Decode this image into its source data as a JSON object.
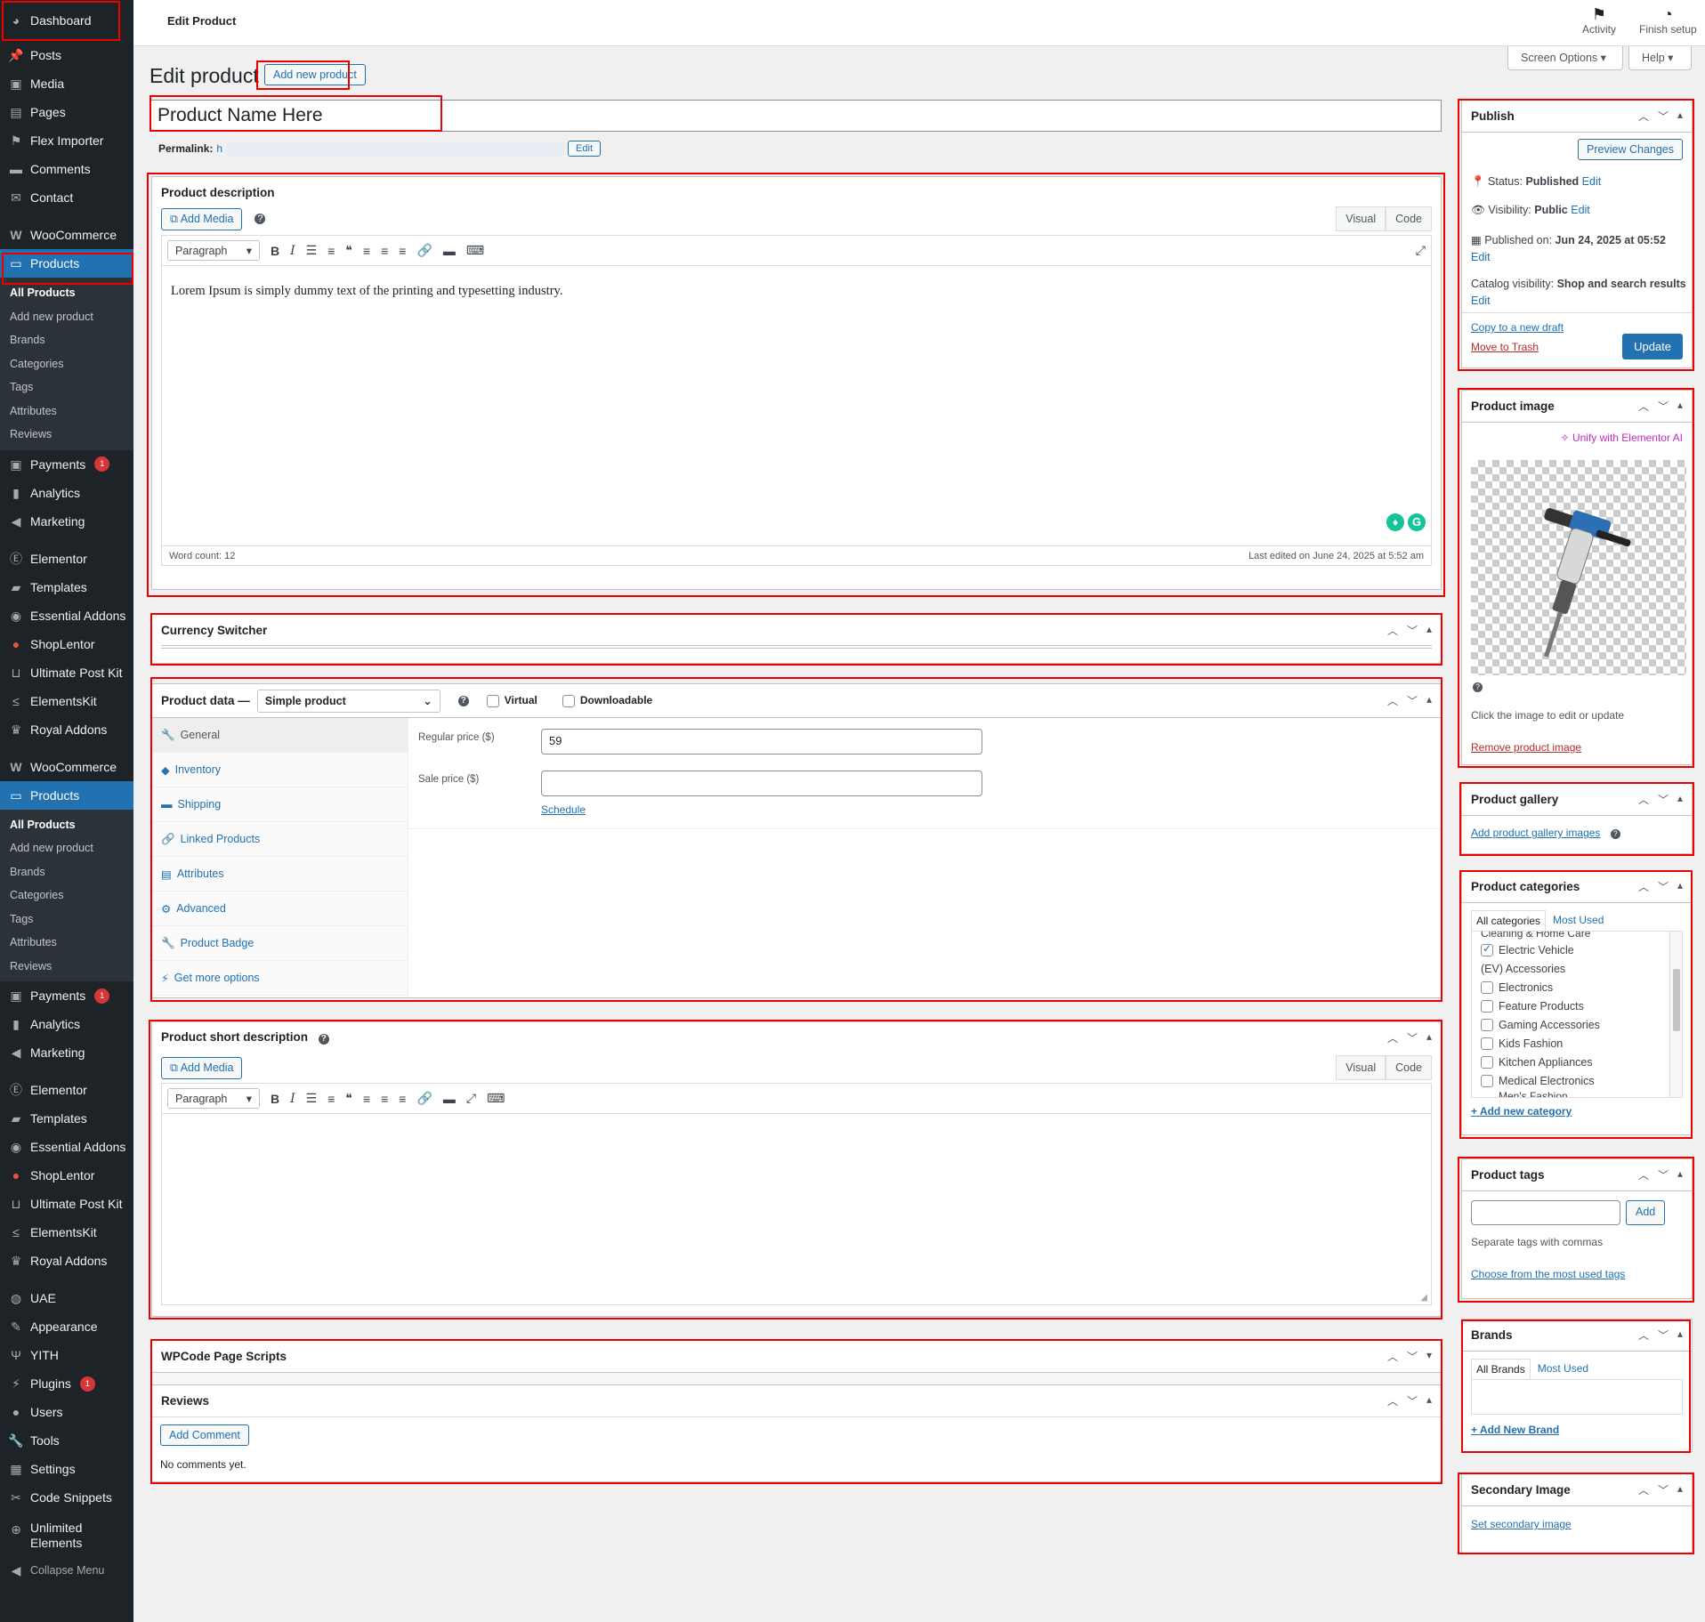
{
  "sidebar": {
    "dashboard": "Dashboard",
    "posts": "Posts",
    "media": "Media",
    "pages": "Pages",
    "flex_importer": "Flex Importer",
    "comments": "Comments",
    "contact": "Contact",
    "woocommerce": "WooCommerce",
    "products": "Products",
    "products_sub": [
      "All Products",
      "Add new product",
      "Brands",
      "Categories",
      "Tags",
      "Attributes",
      "Reviews"
    ],
    "payments": "Payments",
    "payments_badge": "1",
    "analytics": "Analytics",
    "marketing": "Marketing",
    "elementor": "Elementor",
    "templates": "Templates",
    "essential_addons": "Essential Addons",
    "shoplentor": "ShopLentor",
    "ultimate_post_kit": "Ultimate Post Kit",
    "elementskit": "ElementsKit",
    "royal_addons": "Royal Addons",
    "uae": "UAE",
    "appearance": "Appearance",
    "yith": "YITH",
    "plugins": "Plugins",
    "plugins_badge": "1",
    "users": "Users",
    "tools": "Tools",
    "settings": "Settings",
    "code_snippets": "Code Snippets",
    "unlimited_elements_1": "Unlimited",
    "unlimited_elements_2": "Elements",
    "collapse": "Collapse Menu"
  },
  "topbar": {
    "title": "Edit Product",
    "activity": "Activity",
    "finish_setup": "Finish setup",
    "screen_options": "Screen Options ▾",
    "help": "Help ▾"
  },
  "main": {
    "heading": "Edit product",
    "add_new": "Add new product",
    "product_name": "Product Name Here",
    "permalink_label": "Permalink:",
    "permalink_value": "h",
    "permalink_edit": "Edit"
  },
  "description": {
    "title": "Product description",
    "add_media": "Add Media",
    "tab_visual": "Visual",
    "tab_code": "Code",
    "format": "Paragraph",
    "content": "Lorem Ipsum is simply dummy text of the printing and typesetting industry.",
    "word_count": "Word count: 12",
    "last_edited": "Last edited on June 24, 2025 at 5:52 am"
  },
  "currency": {
    "title": "Currency Switcher"
  },
  "product_data": {
    "title": "Product data —",
    "type": "Simple product",
    "virtual": "Virtual",
    "downloadable": "Downloadable",
    "tabs": [
      "General",
      "Inventory",
      "Shipping",
      "Linked Products",
      "Attributes",
      "Advanced",
      "Product Badge",
      "Get more options"
    ],
    "regular_price_label": "Regular price ($)",
    "regular_price": "59",
    "sale_price_label": "Sale price ($)",
    "sale_price": "",
    "schedule": "Schedule"
  },
  "short_description": {
    "title": "Product short description",
    "add_media": "Add Media",
    "tab_visual": "Visual",
    "tab_code": "Code",
    "format": "Paragraph"
  },
  "wpcode": {
    "title": "WPCode Page Scripts"
  },
  "reviews": {
    "title": "Reviews",
    "add_comment": "Add Comment",
    "empty": "No comments yet."
  },
  "publish": {
    "title": "Publish",
    "preview": "Preview Changes",
    "status_label": "Status:",
    "status_value": "Published",
    "visibility_label": "Visibility:",
    "visibility_value": "Public",
    "published_label": "Published on:",
    "published_value": "Jun 24, 2025 at 05:52",
    "catalog_label": "Catalog visibility:",
    "catalog_value": "Shop and search results",
    "edit": "Edit",
    "copy_draft": "Copy to a new draft",
    "trash": "Move to Trash",
    "update": "Update"
  },
  "product_image": {
    "title": "Product image",
    "unify": "Unify with Elementor AI",
    "hint": "Click the image to edit or update",
    "remove": "Remove product image"
  },
  "gallery": {
    "title": "Product gallery",
    "add": "Add product gallery images"
  },
  "categories": {
    "title": "Product categories",
    "tab_all": "All categories",
    "tab_most": "Most Used",
    "cut_top": "Cleaning & Home Care",
    "items": [
      {
        "label": "Electric Vehicle",
        "checked": true,
        "box": true
      },
      {
        "label": "(EV) Accessories",
        "checked": false,
        "box": false
      },
      {
        "label": "Electronics",
        "checked": false,
        "box": true
      },
      {
        "label": "Feature Products",
        "checked": false,
        "box": true
      },
      {
        "label": "Gaming Accessories",
        "checked": false,
        "box": true
      },
      {
        "label": "Kids Fashion",
        "checked": false,
        "box": true
      },
      {
        "label": "Kitchen Appliances",
        "checked": false,
        "box": true
      },
      {
        "label": "Medical Electronics",
        "checked": false,
        "box": true
      }
    ],
    "cut_bottom": "Men's Fashion",
    "add_new": "+ Add new category"
  },
  "tags": {
    "title": "Product tags",
    "add": "Add",
    "hint": "Separate tags with commas",
    "choose": "Choose from the most used tags"
  },
  "brands": {
    "title": "Brands",
    "tab_all": "All Brands",
    "tab_most": "Most Used",
    "add_new": "+ Add New Brand"
  },
  "secondary_image": {
    "title": "Secondary Image",
    "set": "Set secondary image"
  },
  "colors": {
    "accent": "#2271b1",
    "sidebar": "#1d2327",
    "highlight": "#dd0000",
    "trash": "#b32d2e"
  }
}
